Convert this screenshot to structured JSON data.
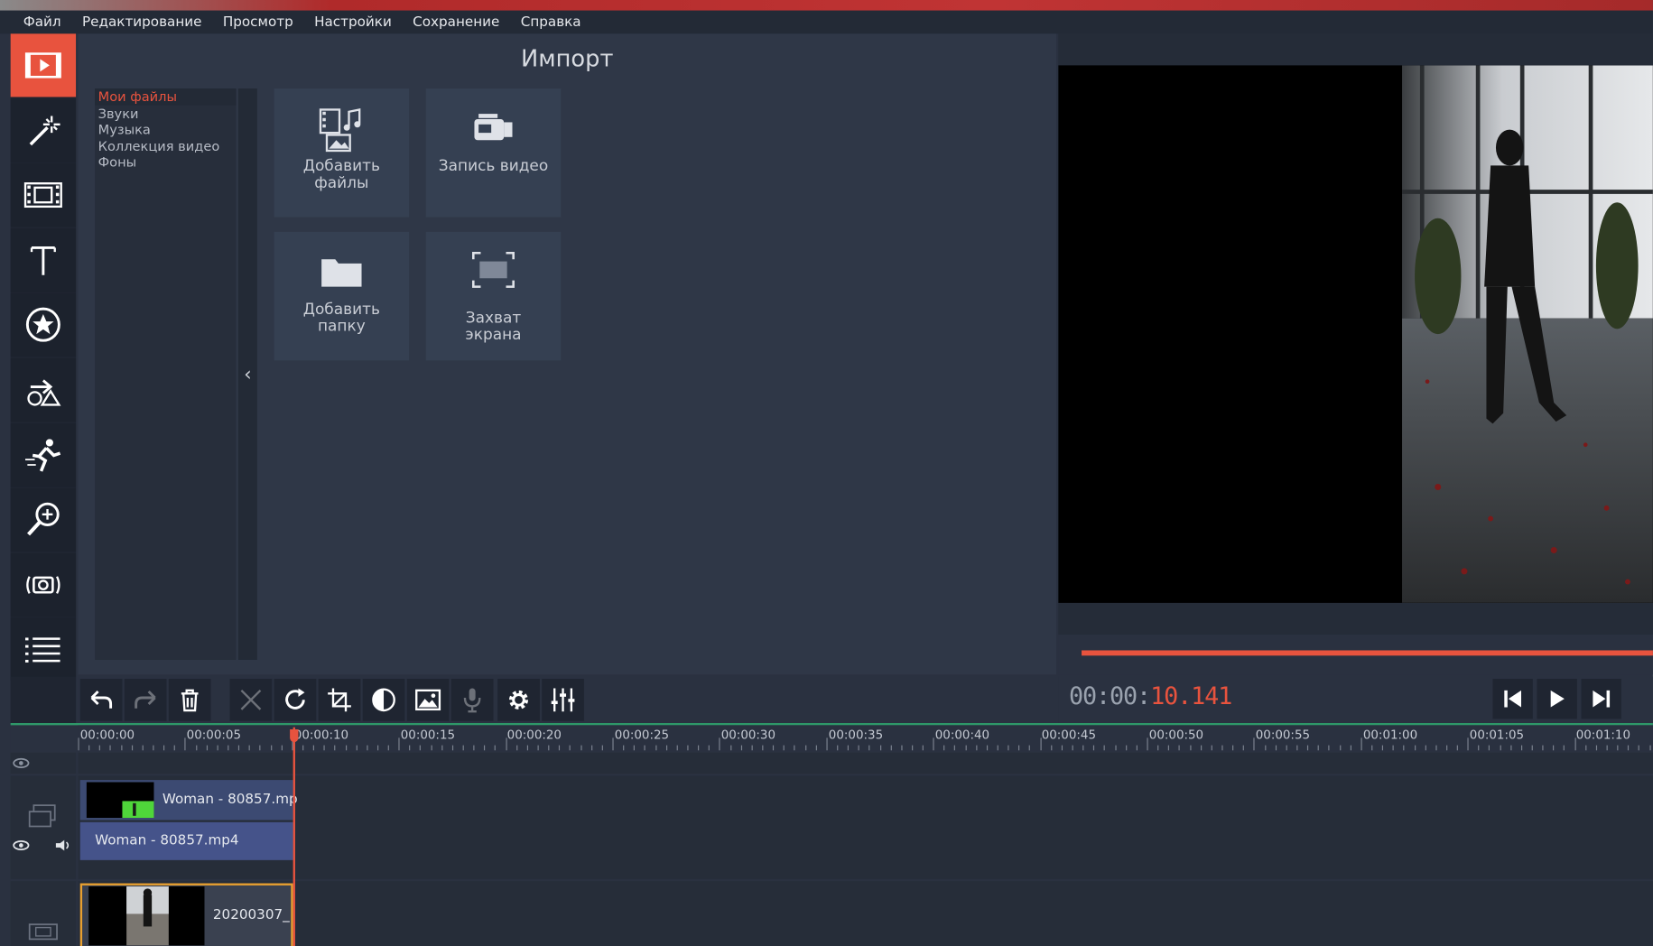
{
  "menu": [
    "Файл",
    "Редактирование",
    "Просмотр",
    "Настройки",
    "Сохранение",
    "Справка"
  ],
  "import_panel": {
    "title": "Импорт",
    "tree": [
      "Мои файлы",
      "Звуки",
      "Музыка",
      "Коллекция видео",
      "Фоны"
    ],
    "tiles": {
      "add_files": "Добавить файлы",
      "record_video": "Запись видео",
      "add_folder": "Добавить папку",
      "screen_capture": "Захват экрана"
    }
  },
  "player": {
    "timecode_dim": "00:00:",
    "timecode_active": "10.141"
  },
  "timeline": {
    "ticks": [
      "00:00:00",
      "00:00:05",
      "00:00:10",
      "00:00:15",
      "00:00:20",
      "00:00:25",
      "00:00:30",
      "00:00:35",
      "00:00:40",
      "00:00:45",
      "00:00:50",
      "00:00:55",
      "00:01:00",
      "00:01:05",
      "00:01:10"
    ],
    "overlay_clip_video": "Woman - 80857.mp",
    "overlay_clip_audio": "Woman - 80857.mp4",
    "main_clip": "20200307_"
  },
  "colors": {
    "accent": "#e8533e",
    "panel": "#2f3747",
    "background": "#2a3140"
  }
}
